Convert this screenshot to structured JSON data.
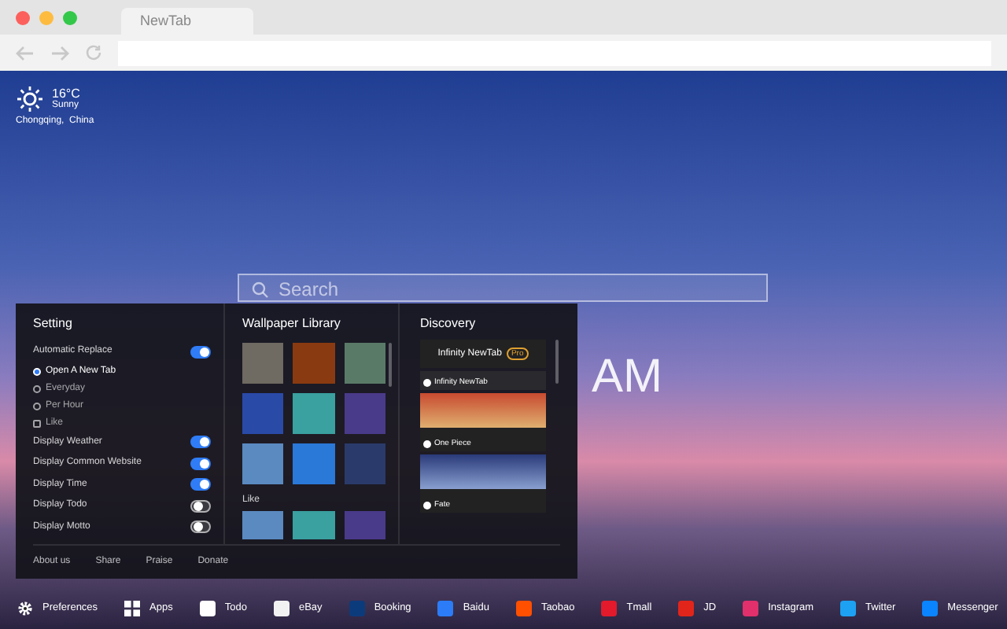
{
  "browser": {
    "tab_title": "NewTab"
  },
  "weather": {
    "temperature": "16°C",
    "condition": "Sunny",
    "location": "Chongqing,  China"
  },
  "search": {
    "placeholder": "Search"
  },
  "clock": {
    "text": "AM"
  },
  "settings": {
    "title": "Setting",
    "options": [
      {
        "kind": "toggle",
        "label": "Automatic Replace",
        "on": true
      },
      {
        "kind": "radio",
        "label": "Open A New Tab",
        "selected": true
      },
      {
        "kind": "radio",
        "label": "Everyday",
        "selected": false
      },
      {
        "kind": "radio",
        "label": "Per Hour",
        "selected": false
      },
      {
        "kind": "checkbox",
        "label": "Like",
        "checked": false
      },
      {
        "kind": "toggle",
        "label": "Display Weather",
        "on": true
      },
      {
        "kind": "toggle",
        "label": "Display Common Website",
        "on": true
      },
      {
        "kind": "toggle",
        "label": "Display Time",
        "on": true
      },
      {
        "kind": "toggle",
        "label": "Display Todo",
        "on": false
      },
      {
        "kind": "toggle",
        "label": "Display Motto",
        "on": false
      }
    ],
    "links": [
      "About us",
      "Share",
      "Praise",
      "Donate"
    ]
  },
  "wallpaper_library": {
    "title": "Wallpaper Library",
    "like_label": "Like"
  },
  "discovery": {
    "title": "Discovery",
    "header": "Infinity NewTab",
    "badge": "Pro",
    "items": [
      {
        "label": "Infinity NewTab"
      },
      {
        "label": "One Piece"
      },
      {
        "label": "Fate"
      }
    ]
  },
  "dock": [
    {
      "kind": "gear",
      "label": "Preferences"
    },
    {
      "kind": "grid",
      "label": "Apps"
    },
    {
      "kind": "tile",
      "label": "Todo",
      "color": "#ffffff"
    },
    {
      "kind": "tile",
      "label": "eBay",
      "color": "#f2f2f2"
    },
    {
      "kind": "tile",
      "label": "Booking",
      "color": "#0c3b7c"
    },
    {
      "kind": "tile",
      "label": "Baidu",
      "color": "#2b7cf6"
    },
    {
      "kind": "tile",
      "label": "Taobao",
      "color": "#ff5000"
    },
    {
      "kind": "tile",
      "label": "Tmall",
      "color": "#e21a2c"
    },
    {
      "kind": "tile",
      "label": "JD",
      "color": "#e1251b"
    },
    {
      "kind": "tile",
      "label": "Instagram",
      "color": "#e1306c"
    },
    {
      "kind": "tile",
      "label": "Twitter",
      "color": "#1da1f2"
    },
    {
      "kind": "tile",
      "label": "Messenger",
      "color": "#0a84ff"
    }
  ]
}
